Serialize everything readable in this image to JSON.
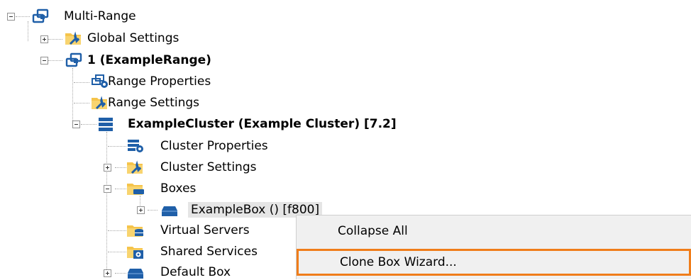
{
  "tree": {
    "root": {
      "label": "Multi-Range",
      "icon": "range-group-icon"
    },
    "global_settings": {
      "label": "Global Settings",
      "icon": "settings-folder-icon"
    },
    "range": {
      "label": "1 (ExampleRange)",
      "icon": "range-group-icon"
    },
    "range_properties": {
      "label": "Range Properties",
      "icon": "range-properties-icon"
    },
    "range_settings": {
      "label": "Range Settings",
      "icon": "settings-folder-icon"
    },
    "cluster": {
      "label": "ExampleCluster (Example Cluster) [7.2]",
      "icon": "server-stack-icon"
    },
    "cluster_properties": {
      "label": "Cluster Properties",
      "icon": "cluster-properties-icon"
    },
    "cluster_settings": {
      "label": "Cluster Settings",
      "icon": "settings-folder-icon"
    },
    "boxes": {
      "label": "Boxes",
      "icon": "boxes-folder-icon"
    },
    "example_box": {
      "label": "ExampleBox () [f800]",
      "icon": "box-icon"
    },
    "virtual_servers": {
      "label": "Virtual Servers",
      "icon": "database-folder-icon"
    },
    "shared_services": {
      "label": "Shared Services",
      "icon": "shared-services-icon"
    },
    "default_box": {
      "label": "Default Box",
      "icon": "box-icon"
    }
  },
  "context_menu": {
    "items": [
      {
        "label": "Collapse All"
      },
      {
        "label": "Clone Box Wizard..."
      }
    ]
  },
  "colors": {
    "highlight_border": "#f07d1a",
    "menu_background": "#f0f0f0",
    "icon_blue": "#1f5fa8",
    "folder_yellow": "#f5c44b"
  }
}
